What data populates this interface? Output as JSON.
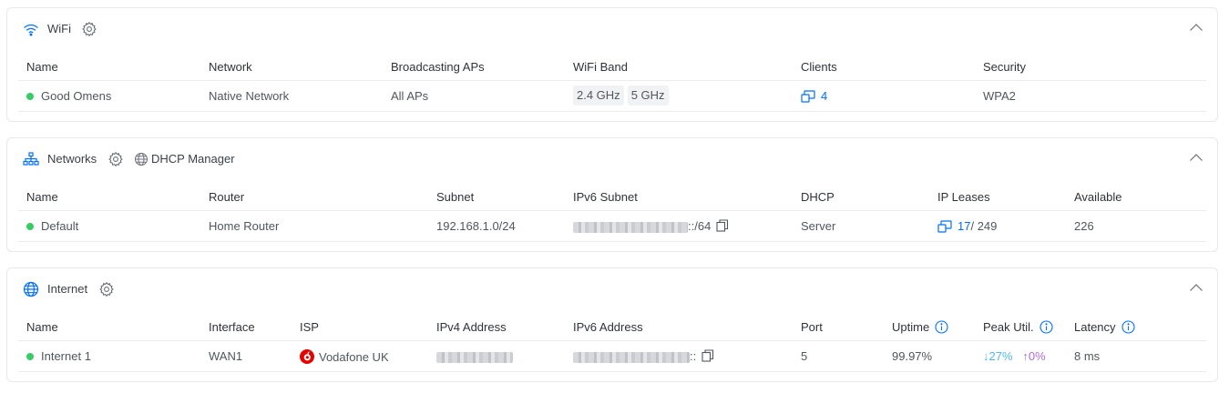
{
  "colors": {
    "accent": "#006fff",
    "online": "#38cc65",
    "down": "#4fb8ea",
    "up": "#b06bd8",
    "vodafone": "#e60000"
  },
  "wifi": {
    "title": "WiFi",
    "icon": "wifi-icon",
    "columns": [
      "Name",
      "Network",
      "Broadcasting APs",
      "WiFi Band",
      "Clients",
      "Security"
    ],
    "row": {
      "name": "Good Omens",
      "network": "Native Network",
      "aps": "All APs",
      "bands": [
        "2.4 GHz",
        "5 GHz"
      ],
      "clients": "4",
      "security": "WPA2"
    }
  },
  "networks": {
    "title": "Networks",
    "icon": "network-tree-icon",
    "dhcp_link": "DHCP Manager",
    "columns": [
      "Name",
      "Router",
      "Subnet",
      "IPv6 Subnet",
      "DHCP",
      "IP Leases",
      "Available"
    ],
    "row": {
      "name": "Default",
      "router": "Home Router",
      "subnet": "192.168.1.0/24",
      "ipv6_suffix": "::/64",
      "dhcp": "Server",
      "leases_used": "17",
      "leases_total": "/ 249",
      "available": "226"
    }
  },
  "internet": {
    "title": "Internet",
    "icon": "globe-icon",
    "columns": [
      "Name",
      "Interface",
      "ISP",
      "IPv4 Address",
      "IPv6 Address",
      "Port",
      "Uptime",
      "Peak Util.",
      "Latency"
    ],
    "row": {
      "name": "Internet 1",
      "interface": "WAN1",
      "isp": "Vodafone UK",
      "ipv6_suffix": "::",
      "port": "5",
      "uptime": "99.97%",
      "peak_down": "↓27%",
      "peak_up": "↑0%",
      "latency": "8 ms"
    }
  }
}
